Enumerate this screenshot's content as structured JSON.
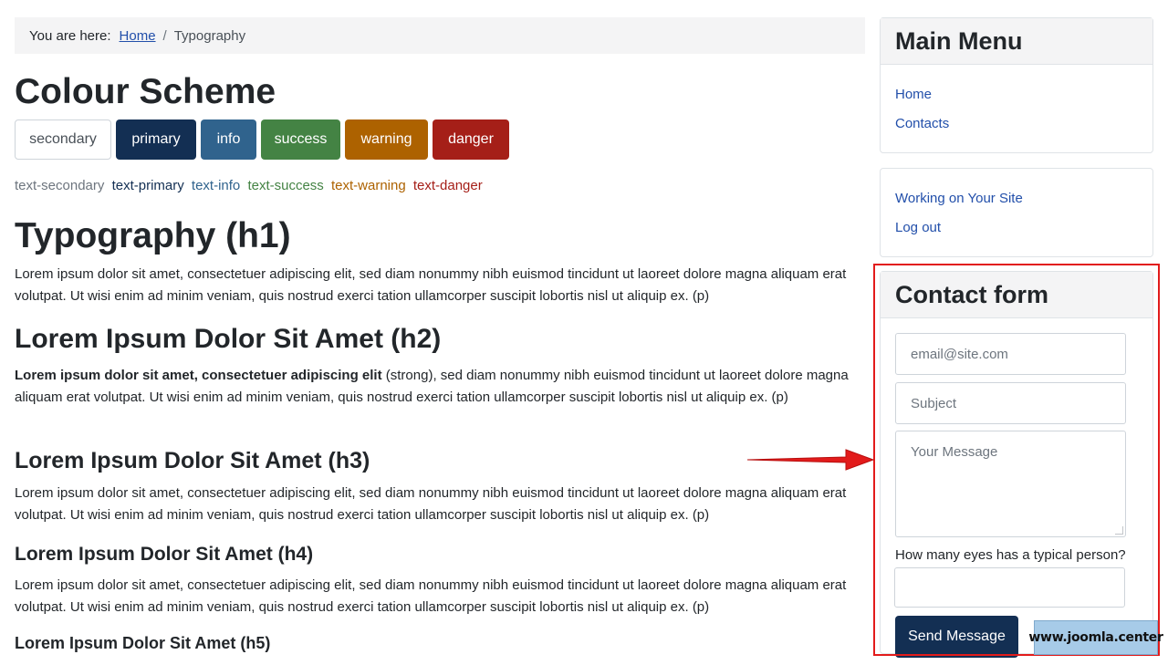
{
  "breadcrumb": {
    "label": "You are here:",
    "home": "Home",
    "separator": "/",
    "current": "Typography"
  },
  "colour_scheme": {
    "title": "Colour Scheme",
    "buttons": [
      "secondary",
      "primary",
      "info",
      "success",
      "warning",
      "danger"
    ],
    "text_samples": [
      "text-secondary",
      "text-primary",
      "text-info",
      "text-success",
      "text-warning",
      "text-danger"
    ],
    "colors": {
      "secondary": "#6d757e",
      "primary": "#132f53",
      "info": "#30638d",
      "success": "#448344",
      "warning": "#ad6200",
      "danger": "#a51f18"
    }
  },
  "typography": {
    "h1": "Typography (h1)",
    "p1": "Lorem ipsum dolor sit amet, consectetuer adipiscing elit, sed diam nonummy nibh euismod tincidunt ut laoreet dolore magna aliquam erat volutpat. Ut wisi enim ad minim veniam, quis nostrud exerci tation ullamcorper suscipit lobortis nisl ut aliquip ex. (p)",
    "h2": "Lorem Ipsum Dolor Sit Amet (h2)",
    "p2_strong": "Lorem ipsum dolor sit amet, consectetuer adipiscing elit",
    "p2_rest": " (strong), sed diam nonummy nibh euismod tincidunt ut laoreet dolore magna aliquam erat volutpat. Ut wisi enim ad minim veniam, quis nostrud exerci tation ullamcorper suscipit lobortis nisl ut aliquip ex. (p)",
    "h3": "Lorem Ipsum Dolor Sit Amet (h3)",
    "p3": "Lorem ipsum dolor sit amet, consectetuer adipiscing elit, sed diam nonummy nibh euismod tincidunt ut laoreet dolore magna aliquam erat volutpat. Ut wisi enim ad minim veniam, quis nostrud exerci tation ullamcorper suscipit lobortis nisl ut aliquip ex. (p)",
    "h4": "Lorem Ipsum Dolor Sit Amet (h4)",
    "p4": "Lorem ipsum dolor sit amet, consectetuer adipiscing elit, sed diam nonummy nibh euismod tincidunt ut laoreet dolore magna aliquam erat volutpat. Ut wisi enim ad minim veniam, quis nostrud exerci tation ullamcorper suscipit lobortis nisl ut aliquip ex. (p)",
    "h5": "Lorem Ipsum Dolor Sit Amet (h5)"
  },
  "main_menu": {
    "title": "Main Menu",
    "items": [
      "Home",
      "Contacts"
    ]
  },
  "user_menu": {
    "items": [
      "Working on Your Site",
      "Log out"
    ]
  },
  "contact_form": {
    "title": "Contact form",
    "email_placeholder": "email@site.com",
    "subject_placeholder": "Subject",
    "message_placeholder": "Your Message",
    "question": "How many eyes has a typical person?",
    "answer_value": "",
    "submit_label": "Send Message"
  },
  "watermark": "www.joomla.center",
  "annotation_color": "#e21b1b"
}
